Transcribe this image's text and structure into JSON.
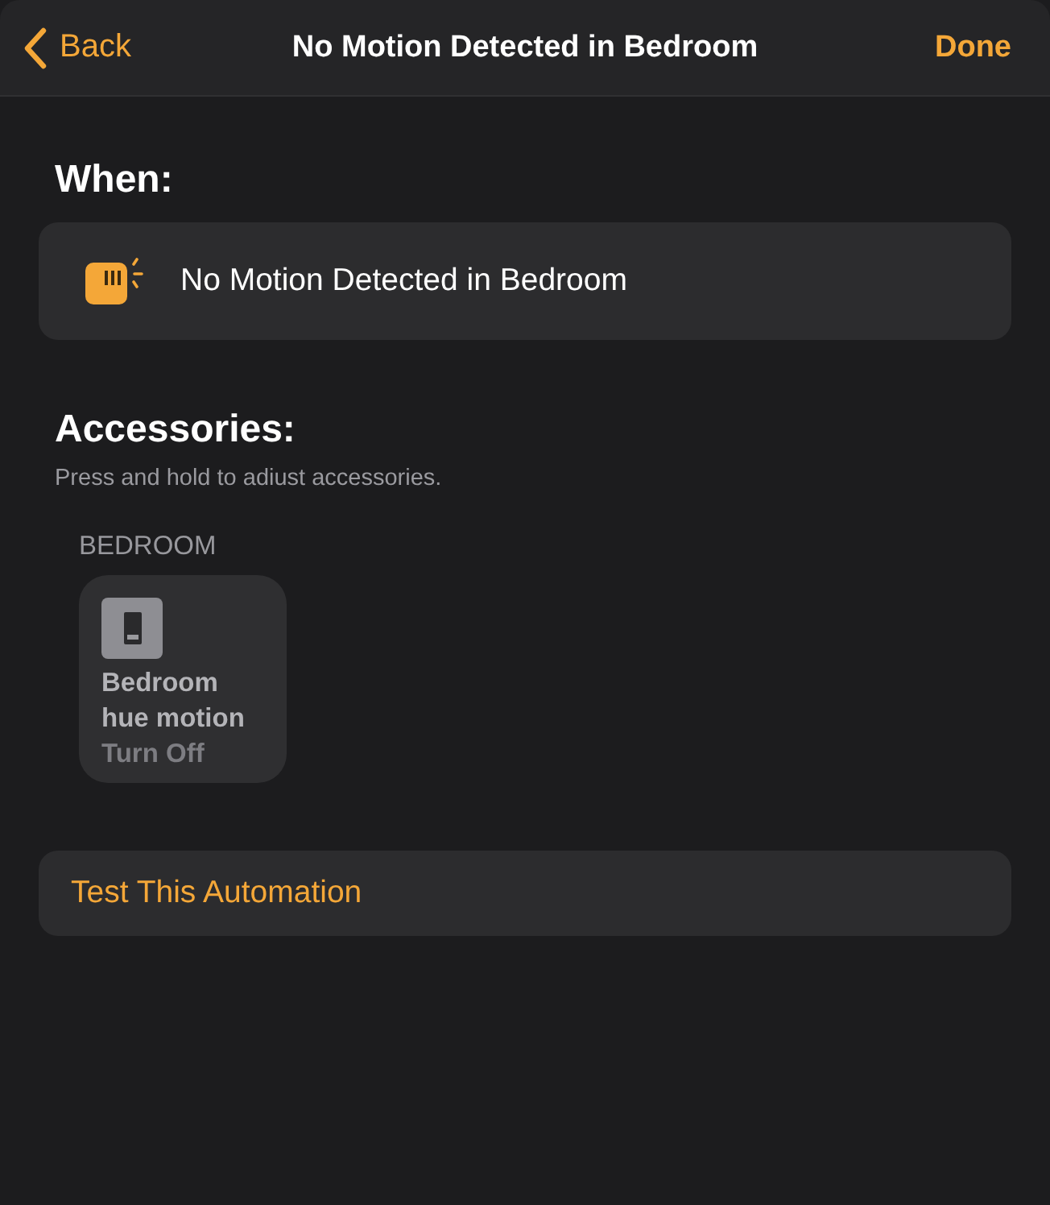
{
  "nav_bar": {
    "back": "Back",
    "title": "No Motion Detected in Bedroom",
    "done": "Done"
  },
  "when": {
    "heading": "When:",
    "trigger": "No Motion Detected in Bedroom"
  },
  "accessories": {
    "heading": "Accessories:",
    "hint": "Press and hold to adiust accessories.",
    "rooms": [
      {
        "name": "BEDROOM",
        "items": [
          {
            "name": "Bedroom hue motion",
            "action": "Turn Off",
            "on": false
          }
        ]
      }
    ]
  },
  "test_button": "Test This Automation"
}
